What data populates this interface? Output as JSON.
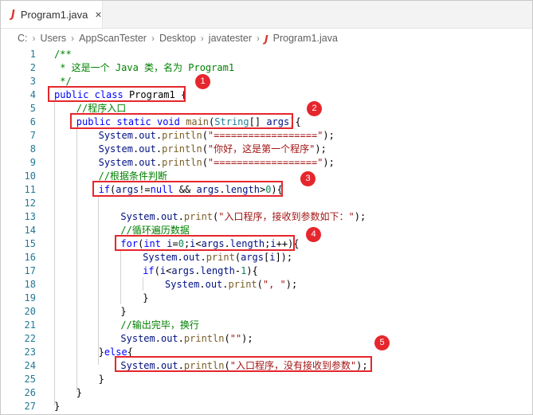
{
  "tab": {
    "label": "Program1.java",
    "close": "×",
    "icon": "J"
  },
  "breadcrumb": {
    "items": [
      "C:",
      "Users",
      "AppScanTester",
      "Desktop",
      "javatester",
      "Program1.java"
    ],
    "separator": "›"
  },
  "editor": {
    "lines": [
      {
        "n": "1"
      },
      {
        "n": "2"
      },
      {
        "n": "3"
      },
      {
        "n": "4"
      },
      {
        "n": "5"
      },
      {
        "n": "6"
      },
      {
        "n": "7"
      },
      {
        "n": "8"
      },
      {
        "n": "9"
      },
      {
        "n": "10"
      },
      {
        "n": "11"
      },
      {
        "n": "12"
      },
      {
        "n": "13"
      },
      {
        "n": "14"
      },
      {
        "n": "15"
      },
      {
        "n": "16"
      },
      {
        "n": "17"
      },
      {
        "n": "18"
      },
      {
        "n": "19"
      },
      {
        "n": "20"
      },
      {
        "n": "21"
      },
      {
        "n": "22"
      },
      {
        "n": "23"
      },
      {
        "n": "24"
      },
      {
        "n": "25"
      },
      {
        "n": "26"
      },
      {
        "n": "27"
      }
    ],
    "code": [
      [
        "/**"
      ],
      [
        " * 这是一个 Java 类，名为 Program1"
      ],
      [
        " */"
      ],
      [
        "public",
        "class",
        "Program1",
        "{"
      ],
      [
        "//程序入口"
      ],
      [
        "public",
        "static",
        "void",
        "main",
        "(",
        "String",
        "[] ",
        "args",
        "){"
      ],
      [
        "System",
        ".",
        "out",
        ".",
        "println",
        "(",
        "\"==================\"",
        ");"
      ],
      [
        "System",
        ".",
        "out",
        ".",
        "println",
        "(",
        "\"你好，这是第一个程序\"",
        ");"
      ],
      [
        "System",
        ".",
        "out",
        ".",
        "println",
        "(",
        "\"==================\"",
        ");"
      ],
      [
        "//根据条件判断"
      ],
      [
        "if",
        "(",
        "args",
        "!=",
        "null",
        " && ",
        "args",
        ".",
        "length",
        ">",
        "0",
        "){"
      ],
      [
        ""
      ],
      [
        "System",
        ".",
        "out",
        ".",
        "print",
        "(",
        "\"入口程序，接收到参数如下：\"",
        ");"
      ],
      [
        "//循环遍历数据"
      ],
      [
        "for",
        "(",
        "int",
        " ",
        "i",
        "=",
        "0",
        ";",
        "i",
        "<",
        "args",
        ".",
        "length",
        ";",
        "i",
        "++){"
      ],
      [
        "System",
        ".",
        "out",
        ".",
        "print",
        "(",
        "args",
        "[",
        "i",
        "]);"
      ],
      [
        "if",
        "(",
        "i",
        "<",
        "args",
        ".",
        "length",
        "-",
        "1",
        "){"
      ],
      [
        "System",
        ".",
        "out",
        ".",
        "print",
        "(",
        "\", \"",
        ");"
      ],
      [
        "}"
      ],
      [
        "}"
      ],
      [
        "//输出完毕，换行"
      ],
      [
        "System",
        ".",
        "out",
        ".",
        "println",
        "(",
        "\"\"",
        ");"
      ],
      [
        "}",
        "else",
        "{"
      ],
      [
        "System",
        ".",
        "out",
        ".",
        "println",
        "(",
        "\"入口程序，没有接收到参数\"",
        ");"
      ],
      [
        "}"
      ],
      [
        "}"
      ],
      [
        "}"
      ]
    ]
  },
  "annotations": [
    {
      "label": "1"
    },
    {
      "label": "2"
    },
    {
      "label": "3"
    },
    {
      "label": "4"
    },
    {
      "label": "5"
    }
  ],
  "colors": {
    "annotation": "#e6262d",
    "keyword": "#0000ff",
    "string": "#a31515",
    "comment": "#008000",
    "number": "#098658",
    "line_number": "#237893"
  }
}
